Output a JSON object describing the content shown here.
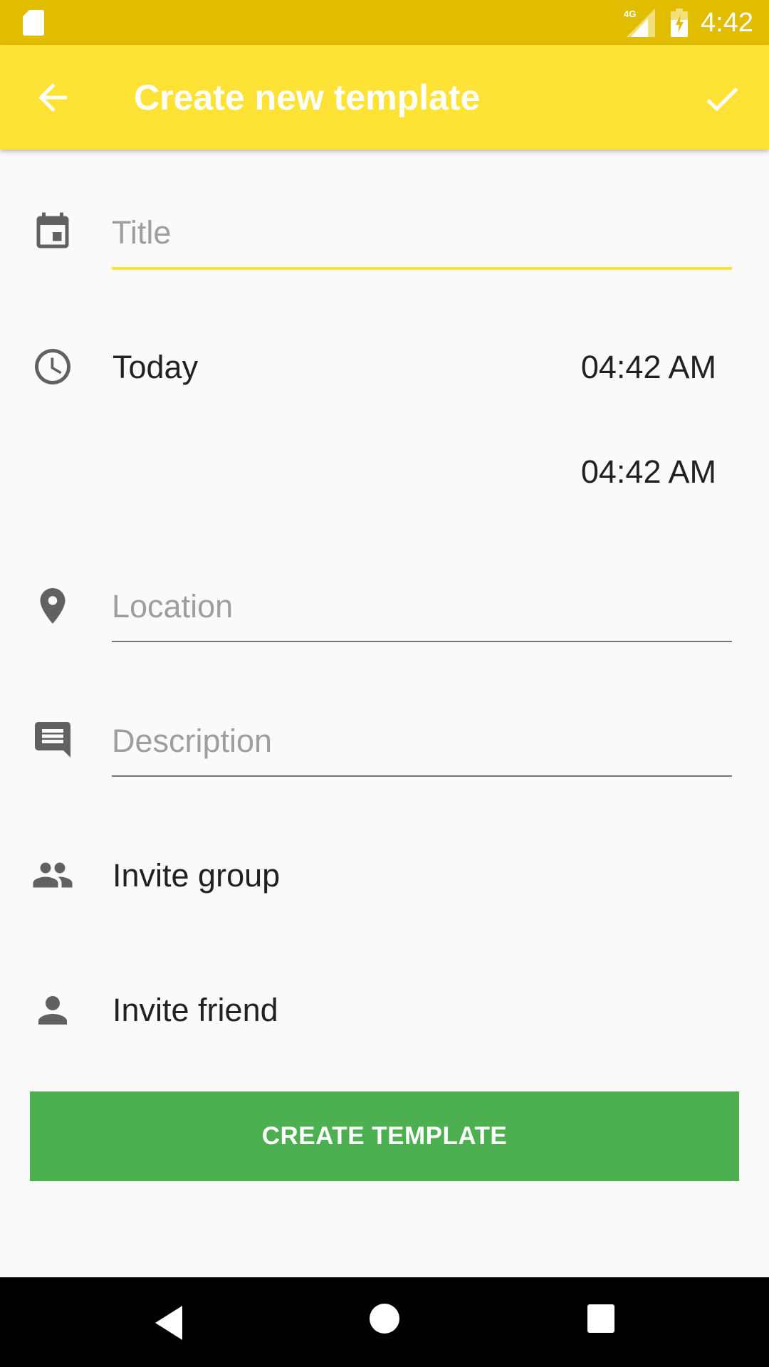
{
  "status_bar": {
    "network_label": "4G",
    "time": "4:42"
  },
  "app_bar": {
    "title": "Create new template",
    "accent_color": "#ffe236",
    "status_color": "#e0bd00"
  },
  "form": {
    "title_field": {
      "placeholder": "Title",
      "value": ""
    },
    "date_label": "Today",
    "start_time": "04:42 AM",
    "end_time": "04:42 AM",
    "location_field": {
      "placeholder": "Location",
      "value": ""
    },
    "description_field": {
      "placeholder": "Description",
      "value": ""
    },
    "invite_group_label": "Invite group",
    "invite_friend_label": "Invite friend"
  },
  "create_button": {
    "label": "CREATE TEMPLATE",
    "color": "#4caf50"
  },
  "icons": {
    "back": "arrow-left-icon",
    "confirm": "check-icon",
    "title": "calendar-icon",
    "time": "clock-icon",
    "location": "location-pin-icon",
    "description": "comment-icon",
    "group": "group-icon",
    "friend": "person-icon"
  }
}
